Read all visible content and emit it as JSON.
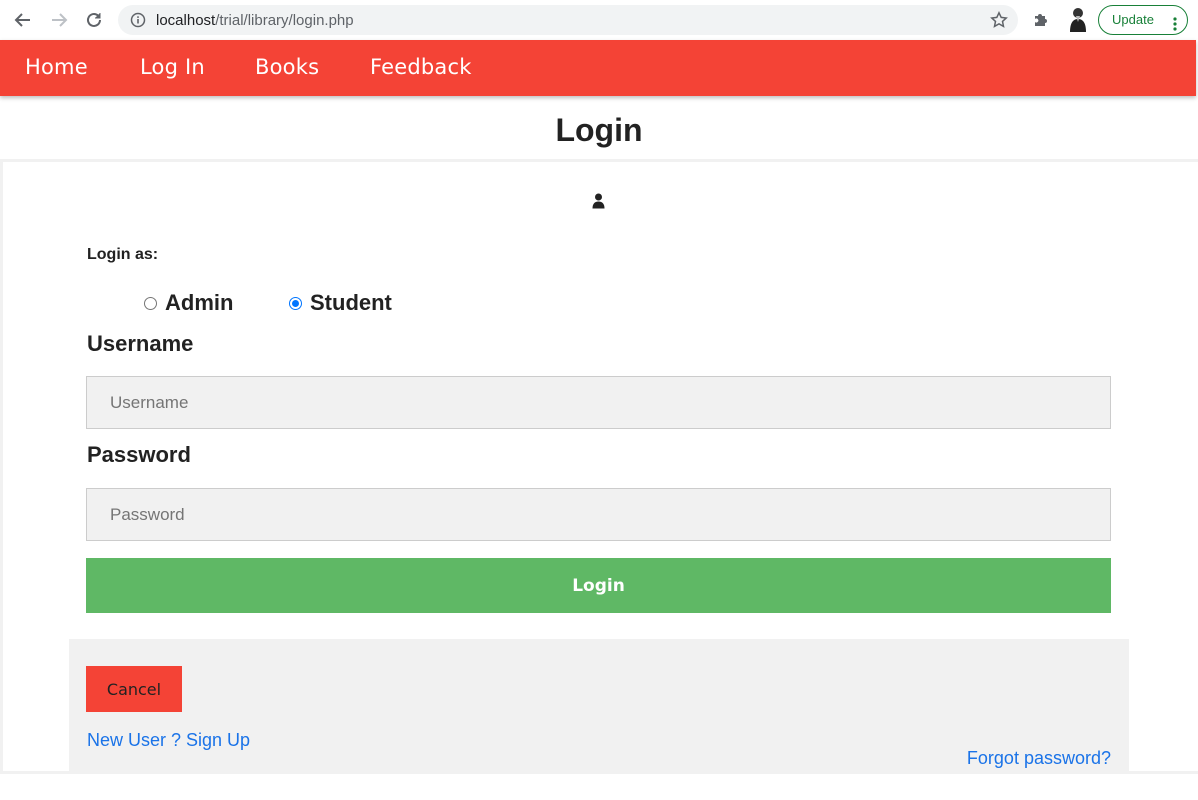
{
  "browser": {
    "url_host": "localhost",
    "url_path": "/trial/library/login.php",
    "update_label": "Update"
  },
  "navbar": {
    "items": [
      "Home",
      "Log In",
      "Books",
      "Feedback"
    ]
  },
  "page": {
    "title": "Login"
  },
  "form": {
    "login_as_label": "Login as:",
    "roles": [
      {
        "label": "Admin",
        "checked": false
      },
      {
        "label": "Student",
        "checked": true
      }
    ],
    "username_label": "Username",
    "username_placeholder": "Username",
    "username_value": "",
    "password_label": "Password",
    "password_placeholder": "Password",
    "password_value": "",
    "login_button": "Login"
  },
  "footer": {
    "cancel_button": "Cancel",
    "signup_link": "New User ? Sign Up",
    "forgot_link": "Forgot password?"
  },
  "colors": {
    "nav_bg": "#f44336",
    "login_btn": "#5fb865",
    "cancel_btn": "#f44336",
    "link": "#1a73e8"
  }
}
